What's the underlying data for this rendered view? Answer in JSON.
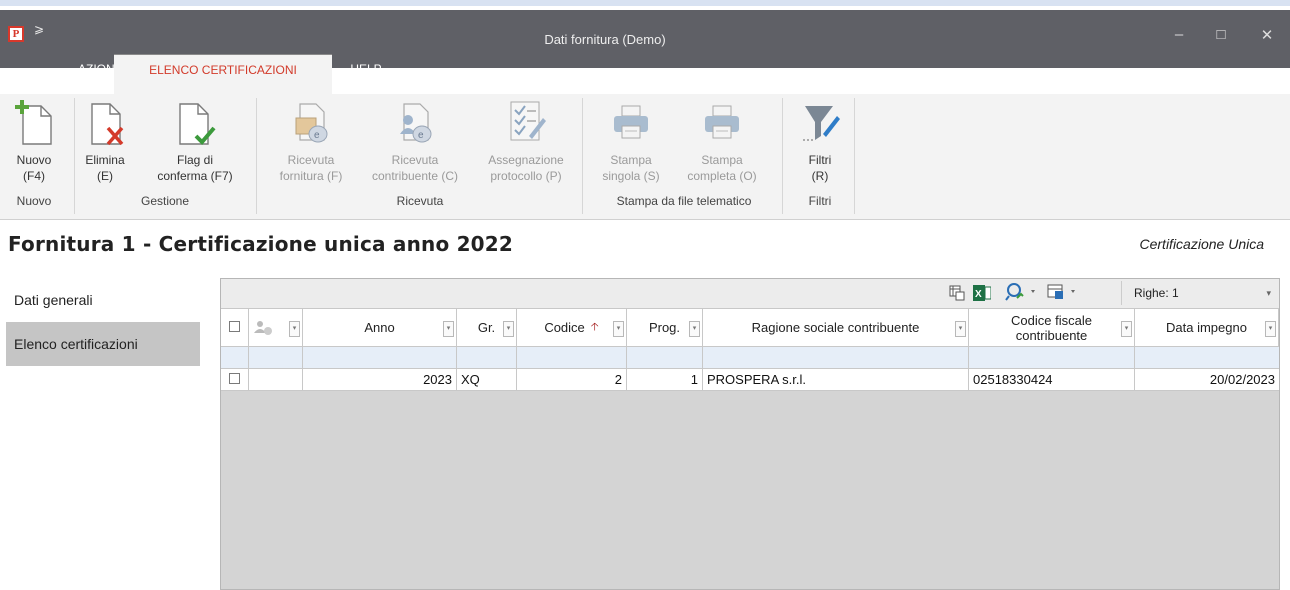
{
  "window": {
    "title": "Dati fornitura  (Demo)",
    "app_icon_letter": "P",
    "qa_glyph": "⩾",
    "minimize": "–",
    "maximize": "□",
    "close": "✕"
  },
  "tabs": [
    {
      "label": "AZIONI"
    },
    {
      "label": "ELENCO CERTIFICAZIONI",
      "active": true
    },
    {
      "label": "HELP"
    }
  ],
  "ribbon_collapse": "^",
  "ribbon": {
    "nuovo": {
      "line1": "Nuovo",
      "line2": "(F4)"
    },
    "elimina": {
      "line1": "Elimina",
      "line2": "(E)"
    },
    "flag": {
      "line1": "Flag di",
      "line2": "conferma (F7)"
    },
    "ric_forn": {
      "line1": "Ricevuta",
      "line2": "fornitura (F)"
    },
    "ric_contr": {
      "line1": "Ricevuta",
      "line2": "contribuente (C)"
    },
    "assegn": {
      "line1": "Assegnazione",
      "line2": "protocollo (P)"
    },
    "stampa_s": {
      "line1": "Stampa",
      "line2": "singola (S)"
    },
    "stampa_c": {
      "line1": "Stampa",
      "line2": "completa (O)"
    },
    "filtri": {
      "line1": "Filtri",
      "line2": "(R)"
    },
    "groups": {
      "nuovo": "Nuovo",
      "gestione": "Gestione",
      "ricevuta": "Ricevuta",
      "stampa": "Stampa da file telematico",
      "filtri": "Filtri"
    }
  },
  "page": {
    "title": "Fornitura 1 - Certificazione unica anno 2022",
    "subtitle": "Certificazione Unica"
  },
  "sidebar": {
    "items": [
      {
        "label": "Dati generali"
      },
      {
        "label": "Elenco certificazioni",
        "selected": true
      }
    ]
  },
  "grid": {
    "righe_label": "Righe: 1",
    "dropdown_glyph": "▾",
    "headers": {
      "anno": "Anno",
      "gr": "Gr.",
      "codice": "Codice",
      "codice_sort": "🡡",
      "prog": "Prog.",
      "ragione": "Ragione sociale contribuente",
      "cf": "Codice fiscale contribuente",
      "data": "Data impegno"
    },
    "rows": [
      {
        "anno": "2023",
        "gr": "XQ",
        "codice": "2",
        "prog": "1",
        "ragione": "PROSPERA s.r.l.",
        "cf": "02518330424",
        "data": "20/02/2023"
      }
    ]
  }
}
